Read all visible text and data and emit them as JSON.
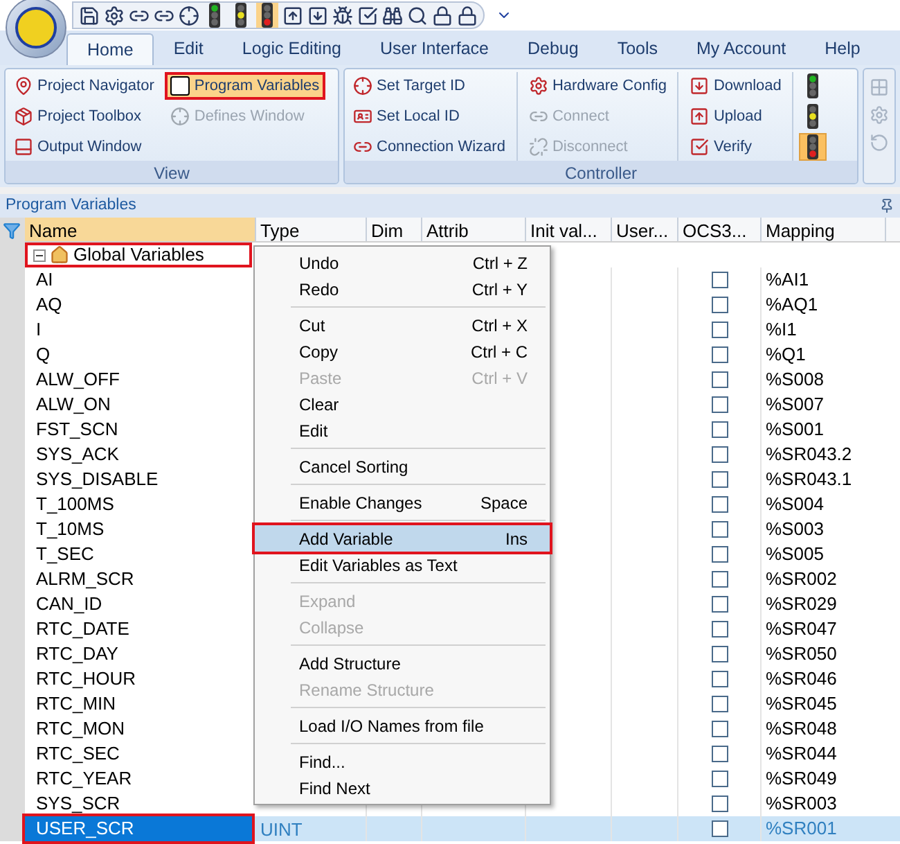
{
  "tabs": [
    {
      "label": "Home",
      "selected": true
    },
    {
      "label": "Edit",
      "selected": false
    },
    {
      "label": "Logic Editing",
      "selected": false
    },
    {
      "label": "User Interface",
      "selected": false
    },
    {
      "label": "Debug",
      "selected": false
    },
    {
      "label": "Tools",
      "selected": false
    },
    {
      "label": "My Account",
      "selected": false
    },
    {
      "label": "Help",
      "selected": false
    }
  ],
  "ribbon": [
    {
      "title": "View",
      "columns": [
        [
          {
            "label": "Project Navigator",
            "disabled": false,
            "selected": false
          },
          {
            "label": "Project Toolbox",
            "disabled": false,
            "selected": false
          },
          {
            "label": "Output Window",
            "disabled": false,
            "selected": false
          }
        ],
        [
          {
            "label": "Program Variables",
            "disabled": false,
            "selected": true
          },
          {
            "label": "Defines Window",
            "disabled": true,
            "selected": false
          }
        ]
      ]
    },
    {
      "title": "Controller",
      "columns": [
        [
          {
            "label": "Set Target  ID",
            "disabled": false,
            "selected": false
          },
          {
            "label": "Set Local  ID",
            "disabled": false,
            "selected": false
          },
          {
            "label": "Connection Wizard",
            "disabled": false,
            "selected": false
          }
        ],
        [
          {
            "label": "Hardware Config",
            "disabled": false,
            "selected": false
          },
          {
            "label": "Connect",
            "disabled": true,
            "selected": false
          },
          {
            "label": "Disconnect",
            "disabled": true,
            "selected": false
          }
        ],
        [
          {
            "label": "Download",
            "disabled": false,
            "selected": false
          },
          {
            "label": "Upload",
            "disabled": false,
            "selected": false
          },
          {
            "label": "Verify",
            "disabled": false,
            "selected": false
          }
        ]
      ],
      "lights": [
        {
          "color": "#22b422",
          "selected": false
        },
        {
          "color": "#e8e020",
          "selected": false
        },
        {
          "color": "#e02020",
          "selected": true
        }
      ]
    }
  ],
  "panel_title": "Program Variables",
  "columns": [
    "Name",
    "Type",
    "Dim",
    "Attrib",
    "Init val...",
    "User...",
    "OCS3...",
    "Mapping"
  ],
  "group": {
    "label": "Global Variables",
    "expanded": true
  },
  "rows": [
    {
      "name": "AI",
      "checked": false,
      "mapping": "%AI1",
      "selected": false
    },
    {
      "name": "AQ",
      "checked": false,
      "mapping": "%AQ1",
      "selected": false
    },
    {
      "name": "I",
      "checked": false,
      "mapping": "%I1",
      "selected": false
    },
    {
      "name": "Q",
      "checked": false,
      "mapping": "%Q1",
      "selected": false
    },
    {
      "name": "ALW_OFF",
      "checked": false,
      "mapping": "%S008",
      "selected": false
    },
    {
      "name": "ALW_ON",
      "checked": false,
      "mapping": "%S007",
      "selected": false
    },
    {
      "name": "FST_SCN",
      "checked": false,
      "mapping": "%S001",
      "selected": false
    },
    {
      "name": "SYS_ACK",
      "checked": false,
      "mapping": "%SR043.2",
      "selected": false
    },
    {
      "name": "SYS_DISABLE",
      "checked": false,
      "mapping": "%SR043.1",
      "selected": false
    },
    {
      "name": "T_100MS",
      "checked": false,
      "mapping": "%S004",
      "selected": false
    },
    {
      "name": "T_10MS",
      "checked": false,
      "mapping": "%S003",
      "selected": false
    },
    {
      "name": "T_SEC",
      "checked": false,
      "mapping": "%S005",
      "selected": false
    },
    {
      "name": "ALRM_SCR",
      "checked": false,
      "mapping": "%SR002",
      "selected": false
    },
    {
      "name": "CAN_ID",
      "checked": false,
      "mapping": "%SR029",
      "selected": false
    },
    {
      "name": "RTC_DATE",
      "checked": false,
      "mapping": "%SR047",
      "selected": false
    },
    {
      "name": "RTC_DAY",
      "checked": false,
      "mapping": "%SR050",
      "selected": false
    },
    {
      "name": "RTC_HOUR",
      "checked": false,
      "mapping": "%SR046",
      "selected": false
    },
    {
      "name": "RTC_MIN",
      "checked": false,
      "mapping": "%SR045",
      "selected": false
    },
    {
      "name": "RTC_MON",
      "checked": false,
      "mapping": "%SR048",
      "selected": false
    },
    {
      "name": "RTC_SEC",
      "checked": false,
      "mapping": "%SR044",
      "selected": false
    },
    {
      "name": "RTC_YEAR",
      "checked": false,
      "mapping": "%SR049",
      "selected": false
    },
    {
      "name": "SYS_SCR",
      "checked": false,
      "mapping": "%SR003",
      "selected": false
    },
    {
      "name": "USER_SCR",
      "type": "UINT",
      "checked": false,
      "mapping": "%SR001",
      "selected": true
    }
  ],
  "context_menu": [
    {
      "kind": "item",
      "label": "Undo",
      "shortcut": "Ctrl + Z",
      "disabled": false,
      "selected": false
    },
    {
      "kind": "item",
      "label": "Redo",
      "shortcut": "Ctrl + Y",
      "disabled": false,
      "selected": false
    },
    {
      "kind": "separator"
    },
    {
      "kind": "item",
      "label": "Cut",
      "shortcut": "Ctrl + X",
      "disabled": false,
      "selected": false
    },
    {
      "kind": "item",
      "label": "Copy",
      "shortcut": "Ctrl + C",
      "disabled": false,
      "selected": false
    },
    {
      "kind": "item",
      "label": "Paste",
      "shortcut": "Ctrl + V",
      "disabled": true,
      "selected": false
    },
    {
      "kind": "item",
      "label": "Clear",
      "disabled": false,
      "selected": false
    },
    {
      "kind": "item",
      "label": "Edit",
      "disabled": false,
      "selected": false
    },
    {
      "kind": "separator"
    },
    {
      "kind": "item",
      "label": "Cancel Sorting",
      "disabled": false,
      "selected": false
    },
    {
      "kind": "separator"
    },
    {
      "kind": "item",
      "label": "Enable Changes",
      "shortcut": "Space",
      "disabled": false,
      "selected": false
    },
    {
      "kind": "separator"
    },
    {
      "kind": "item",
      "label": "Add Variable",
      "shortcut": "Ins",
      "disabled": false,
      "selected": true
    },
    {
      "kind": "item",
      "label": "Edit Variables as Text",
      "disabled": false,
      "selected": false
    },
    {
      "kind": "separator"
    },
    {
      "kind": "item",
      "label": "Expand",
      "disabled": true,
      "selected": false
    },
    {
      "kind": "item",
      "label": "Collapse",
      "disabled": true,
      "selected": false
    },
    {
      "kind": "separator"
    },
    {
      "kind": "item",
      "label": "Add Structure",
      "disabled": false,
      "selected": false
    },
    {
      "kind": "item",
      "label": "Rename Structure",
      "disabled": true,
      "selected": false
    },
    {
      "kind": "separator"
    },
    {
      "kind": "item",
      "label": "Load I/O Names from file",
      "disabled": false,
      "selected": false
    },
    {
      "kind": "separator"
    },
    {
      "kind": "item",
      "label": "Find...",
      "disabled": false,
      "selected": false
    },
    {
      "kind": "item",
      "label": "Find Next",
      "disabled": false,
      "selected": false
    }
  ]
}
